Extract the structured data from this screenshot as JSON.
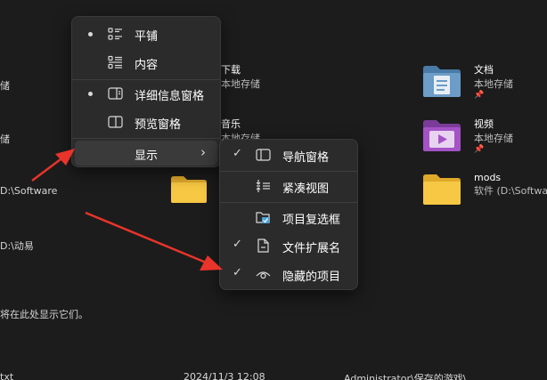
{
  "background": {
    "left_items": [
      "储",
      "储",
      "D:\\Software",
      "D:\\动易"
    ],
    "hint": "将在此处显示它们。",
    "bottom_file": "txt",
    "bottom_date": "2024/11/3 12:08",
    "bottom_path": "Administrator\\保存的游戏\\...",
    "tiles": [
      {
        "name": "下载",
        "sub": "本地存储"
      },
      {
        "name": "音乐",
        "sub": "本地存储"
      },
      {
        "name": "文档",
        "sub": "本地存储"
      },
      {
        "name": "视频",
        "sub": "本地存储"
      },
      {
        "name": "mods",
        "sub": "软件 (D:\\Software"
      }
    ]
  },
  "main_menu": {
    "items": [
      {
        "label": "平铺",
        "icon": "tiles-view-icon",
        "selected": true
      },
      {
        "label": "内容",
        "icon": "content-view-icon",
        "selected": false
      },
      {
        "label": "详细信息窗格",
        "icon": "details-pane-icon",
        "selected": true
      },
      {
        "label": "预览窗格",
        "icon": "preview-pane-icon",
        "selected": false
      },
      {
        "label": "显示",
        "icon": "",
        "submenu_arrow": "›"
      }
    ]
  },
  "show_submenu": {
    "items": [
      {
        "label": "导航窗格",
        "icon": "navigation-pane-icon",
        "checked": true
      },
      {
        "label": "紧凑视图",
        "icon": "compact-view-icon",
        "checked": false
      },
      {
        "label": "项目复选框",
        "icon": "item-checkbox-icon",
        "checked": false
      },
      {
        "label": "文件扩展名",
        "icon": "file-extension-icon",
        "checked": true
      },
      {
        "label": "隐藏的项目",
        "icon": "hidden-items-icon",
        "checked": true
      }
    ],
    "check_glyph": "✓"
  },
  "colors": {
    "annotation_arrow": "#e8342a",
    "folder_yellow": "#f6c844",
    "video_purple": "#8e44ad",
    "docs_blue": "#5b8db8"
  }
}
